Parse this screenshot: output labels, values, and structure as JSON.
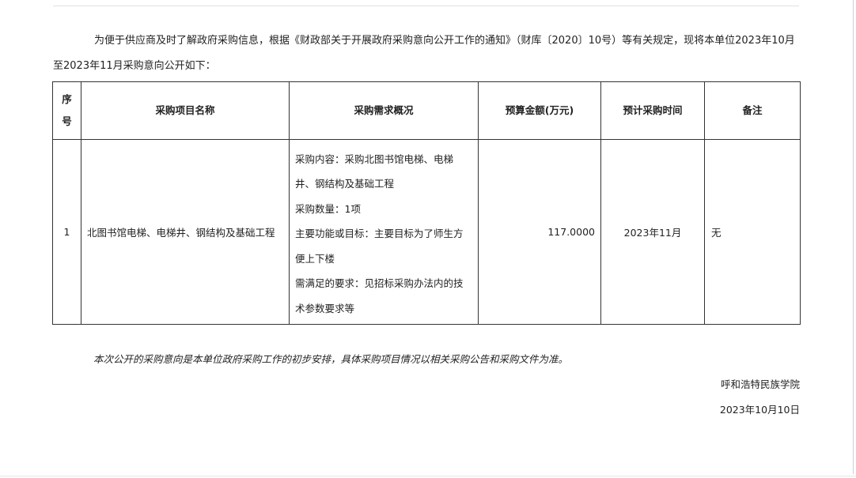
{
  "intro": "为便于供应商及时了解政府采购信息，根据《财政部关于开展政府采购意向公开工作的通知》（财库〔2020〕10号）等有关规定，现将本单位2023年10月至2023年11月采购意向公开如下：",
  "table": {
    "headers": {
      "seq": "序号",
      "name": "采购项目名称",
      "desc": "采购需求概况",
      "budget": "预算金额(万元)",
      "time": "预计采购时间",
      "note": "备注"
    },
    "rows": [
      {
        "seq": "1",
        "name": "北图书馆电梯、电梯井、钢结构及基础工程",
        "desc": {
          "content": "采购内容：采购北图书馆电梯、电梯井、钢结构及基础工程",
          "quantity": "采购数量：1项",
          "goal": "主要功能或目标：主要目标为了师生方便上下楼",
          "requirements": "需满足的要求：见招标采购办法内的技术参数要求等"
        },
        "budget": "117.0000",
        "time": "2023年11月",
        "note": "无"
      }
    ]
  },
  "footer": {
    "note": "本次公开的采购意向是本单位政府采购工作的初步安排，具体采购项目情况以相关采购公告和采购文件为准。",
    "org": "呼和浩特民族学院",
    "date": "2023年10月10日"
  }
}
